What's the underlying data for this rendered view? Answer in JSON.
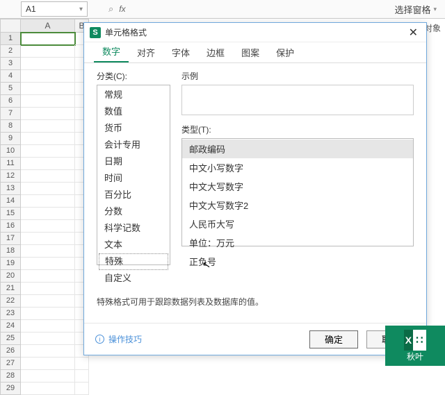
{
  "formula_bar": {
    "cell_ref": "A1",
    "fx_label": "fx"
  },
  "ribbon": {
    "select_pane": "选择窗格",
    "doc_object": "档中的对象"
  },
  "columns": [
    "A",
    "B"
  ],
  "row_count": 29,
  "dialog": {
    "title": "单元格格式",
    "badge": "S",
    "tabs": [
      "数字",
      "对齐",
      "字体",
      "边框",
      "图案",
      "保护"
    ],
    "active_tab": 0,
    "category_label": "分类(C):",
    "categories": [
      "常规",
      "数值",
      "货币",
      "会计专用",
      "日期",
      "时间",
      "百分比",
      "分数",
      "科学记数",
      "文本",
      "特殊",
      "自定义"
    ],
    "selected_category": 10,
    "sample_label": "示例",
    "type_label": "类型(T):",
    "types": [
      "邮政编码",
      "中文小写数字",
      "中文大写数字",
      "中文大写数字2",
      "人民币大写",
      "单位：万元",
      "正负号"
    ],
    "selected_type": 0,
    "hint": "特殊格式可用于跟踪数据列表及数据库的值。",
    "tips_label": "操作技巧",
    "ok": "确定",
    "cancel": "取消"
  },
  "watermark": "秋叶"
}
